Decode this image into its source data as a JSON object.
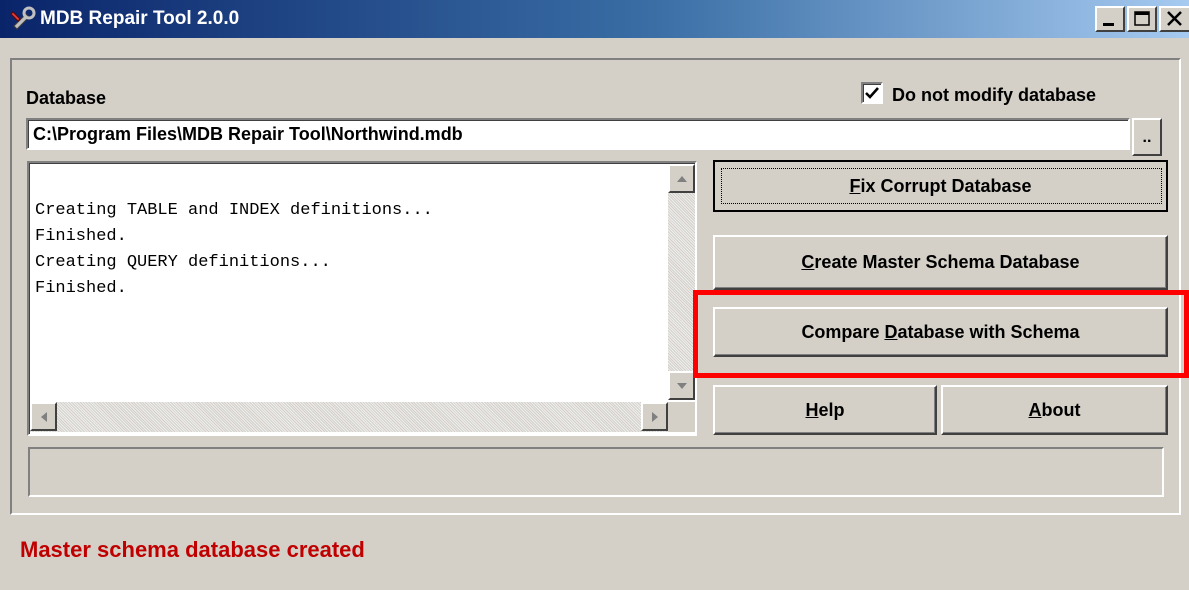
{
  "window": {
    "title": "MDB Repair Tool 2.0.0",
    "icon": "wrench-tool-icon",
    "controls": [
      "minimize-icon",
      "maximize-icon",
      "close-icon"
    ]
  },
  "database": {
    "label": "Database",
    "path": "C:\\Program Files\\MDB Repair Tool\\Northwind.mdb",
    "browse_label": ".."
  },
  "options": {
    "do_not_modify_label": "Do not modify database",
    "do_not_modify_checked": true
  },
  "log": {
    "text": "Creating TABLE and INDEX definitions...\nFinished.\nCreating QUERY definitions...\nFinished."
  },
  "buttons": {
    "fix": {
      "mnemonic": "F",
      "rest": "ix Corrupt Database"
    },
    "create": {
      "mnemonic": "C",
      "rest": "reate Master Schema Database"
    },
    "compare": {
      "before": "Compare ",
      "mnemonic": "D",
      "rest": "atabase with Schema"
    },
    "help": {
      "mnemonic": "H",
      "rest": "elp"
    },
    "about": {
      "mnemonic": "A",
      "rest": "bout"
    }
  },
  "status": {
    "message": "Master schema database created",
    "color": "#c00000"
  },
  "highlight_color": "#ff0000"
}
